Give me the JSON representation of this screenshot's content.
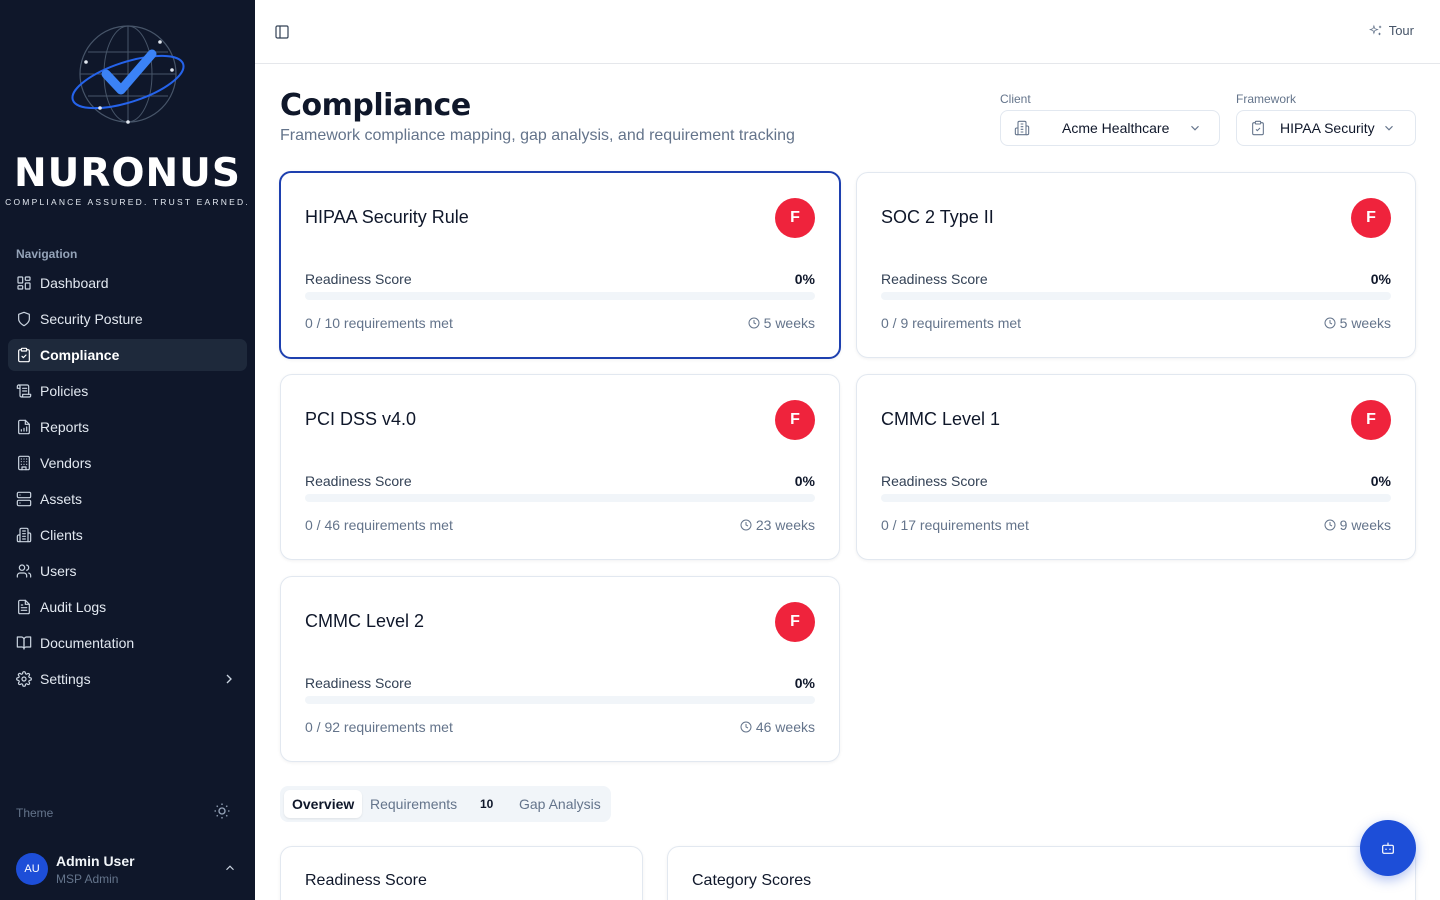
{
  "brand": {
    "name": "NURONUS",
    "tagline": "COMPLIANCE ASSURED. TRUST EARNED.",
    "accent": "#3b82f6"
  },
  "sidebar": {
    "heading": "Navigation",
    "items": [
      {
        "label": "Dashboard",
        "icon": "dashboard-icon"
      },
      {
        "label": "Security Posture",
        "icon": "shield-icon"
      },
      {
        "label": "Compliance",
        "icon": "clipboard-check-icon",
        "active": true
      },
      {
        "label": "Policies",
        "icon": "scroll-icon"
      },
      {
        "label": "Reports",
        "icon": "file-chart-icon"
      },
      {
        "label": "Vendors",
        "icon": "building-icon"
      },
      {
        "label": "Assets",
        "icon": "server-icon"
      },
      {
        "label": "Clients",
        "icon": "building-2-icon"
      },
      {
        "label": "Users",
        "icon": "users-icon"
      },
      {
        "label": "Audit Logs",
        "icon": "file-text-icon"
      },
      {
        "label": "Documentation",
        "icon": "book-open-icon"
      },
      {
        "label": "Settings",
        "icon": "gear-icon"
      }
    ],
    "theme_label": "Theme",
    "user": {
      "initials": "AU",
      "name": "Admin User",
      "role": "MSP Admin"
    }
  },
  "topbar": {
    "tour_label": "Tour"
  },
  "page": {
    "title": "Compliance",
    "subtitle": "Framework compliance mapping, gap analysis, and requirement tracking"
  },
  "filters": {
    "client_label": "Client",
    "client_value": "Acme Healthcare",
    "framework_label": "Framework",
    "framework_value": "HIPAA Security I"
  },
  "frameworks": [
    {
      "name": "HIPAA Security Rule",
      "grade": "F",
      "readiness_label": "Readiness Score",
      "readiness_value": "0%",
      "readiness": 0,
      "requirements": "0 / 10 requirements met",
      "weeks": "5 weeks",
      "selected": true
    },
    {
      "name": "SOC 2 Type II",
      "grade": "F",
      "readiness_label": "Readiness Score",
      "readiness_value": "0%",
      "readiness": 0,
      "requirements": "0 / 9 requirements met",
      "weeks": "5 weeks"
    },
    {
      "name": "PCI DSS v4.0",
      "grade": "F",
      "readiness_label": "Readiness Score",
      "readiness_value": "0%",
      "readiness": 0,
      "requirements": "0 / 46 requirements met",
      "weeks": "23 weeks"
    },
    {
      "name": "CMMC Level 1",
      "grade": "F",
      "readiness_label": "Readiness Score",
      "readiness_value": "0%",
      "readiness": 0,
      "requirements": "0 / 17 requirements met",
      "weeks": "9 weeks"
    },
    {
      "name": "CMMC Level 2",
      "grade": "F",
      "readiness_label": "Readiness Score",
      "readiness_value": "0%",
      "readiness": 0,
      "requirements": "0 / 92 requirements met",
      "weeks": "46 weeks"
    }
  ],
  "tabs": {
    "overview": "Overview",
    "requirements": "Requirements",
    "requirements_count": "10",
    "gap_analysis": "Gap Analysis"
  },
  "panels": {
    "readiness_title": "Readiness Score",
    "category_title": "Category Scores"
  },
  "colors": {
    "sidebar_bg": "#0f172a",
    "grade_fail": "#ef233c",
    "selected_border": "#1e40af",
    "fab": "#1d4ed8"
  }
}
